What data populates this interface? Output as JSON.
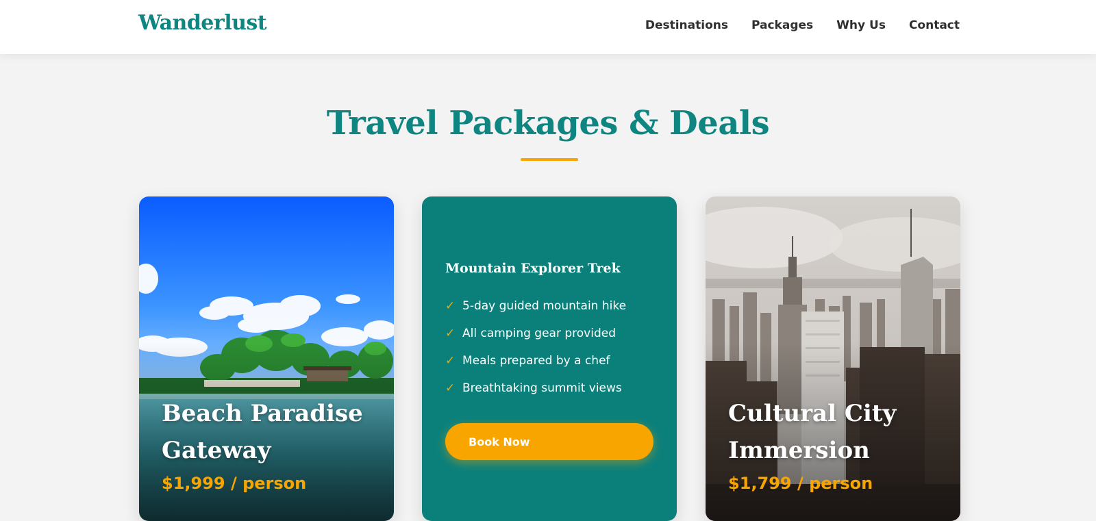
{
  "header": {
    "logo": "Wanderlust",
    "nav": [
      "Destinations",
      "Packages",
      "Why Us",
      "Contact"
    ]
  },
  "section": {
    "title": "Travel Packages & Deals"
  },
  "cards": [
    {
      "title": "Beach Paradise Gateway",
      "price": "$1,999 / person",
      "image": "tropical beach island with palm trees"
    },
    {
      "title": "Mountain Explorer Trek",
      "features": [
        "5-day guided mountain hike",
        "All camping gear provided",
        "Meals prepared by a chef",
        "Breathtaking summit views"
      ],
      "button": "Book Now",
      "check_icon": "✓"
    },
    {
      "title": "Cultural City Immersion",
      "price": "$1,799 / person",
      "image": "city skyline with skyscrapers"
    }
  ],
  "colors": {
    "brand": "#0e8580",
    "accent": "#f8a500",
    "background": "#f3f3f3",
    "card_teal": "#0b807b"
  }
}
